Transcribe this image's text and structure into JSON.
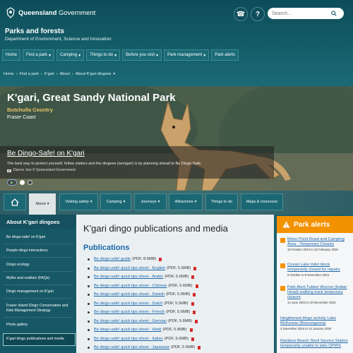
{
  "header": {
    "brand_strong": "Queensland",
    "brand_rest": " Government",
    "phone_icon": "☎",
    "help_icon": "?",
    "search_placeholder": "Search...",
    "site_title": "Parks and forests",
    "site_subtitle": "Department of Environment, Science and Innovation"
  },
  "main_nav": [
    {
      "label": "Home",
      "chevron": ""
    },
    {
      "label": "Find a park",
      "chevron": "▾"
    },
    {
      "label": "Camping",
      "chevron": "▾"
    },
    {
      "label": "Things to do",
      "chevron": "▾"
    },
    {
      "label": "Before you visit",
      "chevron": "▾"
    },
    {
      "label": "Park management",
      "chevron": "▾"
    },
    {
      "label": "Park alerts",
      "chevron": ""
    }
  ],
  "breadcrumb": [
    "Home",
    "Find a park",
    "K'gari",
    "About",
    "About K'gari dingoes"
  ],
  "breadcrumb_sep": "›",
  "hero": {
    "title": "K'gari, Great Sandy National Park",
    "country": "Butchulla Country",
    "region": "Fraser Coast",
    "caption_title": "Be Dingo-Safe! on K'gari",
    "caption_text": "The best way to protect yourself, fellow visitors and the dingoes (wongari) is by planning ahead to Be Dingo-Safe.",
    "caption_credit": "Darren Jew © Queensland Government"
  },
  "sub_nav": [
    {
      "label": "About",
      "chevron": "▾"
    },
    {
      "label": "Visiting safely",
      "chevron": "▾"
    },
    {
      "label": "Camping",
      "chevron": "▾"
    },
    {
      "label": "Journeys",
      "chevron": "▾"
    },
    {
      "label": "Attractions",
      "chevron": "▾"
    },
    {
      "label": "Things to do",
      "chevron": ""
    },
    {
      "label": "Maps & resources",
      "chevron": ""
    }
  ],
  "sidebar": {
    "heading": "About K'gari dingoes",
    "items": [
      "Be dingo-safe! on K'gari",
      "People-dingo interactions",
      "Dingo ecology",
      "Myths and realities (FAQs)",
      "Dingo management on K'gari",
      "Fraser Island Dingo Conservation and Risk Management Strategy",
      "Photo gallery",
      "K'gari dingo publications and media"
    ]
  },
  "content": {
    "title": "K'gari dingo publications and media",
    "section": "Publications",
    "publications": [
      {
        "link": "Be dingo-safe! guide",
        "meta": "(PDF, 8.6MB)"
      },
      {
        "link": "Be dingo-safe! quick tips sheet - English",
        "meta": "(PDF, 5.5MB)"
      },
      {
        "link": "Be dingo-safe! quick tips sheet - Arabic",
        "meta": "(PDF, 5.6MB)"
      },
      {
        "link": "Be dingo-safe! quick tips sheet - Chinese",
        "meta": "(PDF, 5.6MB)"
      },
      {
        "link": "Be dingo-safe! quick tips sheet - Danish",
        "meta": "(PDF, 5.6MB)"
      },
      {
        "link": "Be dingo-safe! quick tips sheet - Dutch",
        "meta": "(PDF, 5.5MB)"
      },
      {
        "link": "Be dingo-safe! quick tips sheet - French",
        "meta": "(PDF, 5.6MB)"
      },
      {
        "link": "Be dingo-safe! quick tips sheet - German",
        "meta": "(PDF, 5.6MB)"
      },
      {
        "link": "Be dingo-safe! quick tips sheet - Hindi",
        "meta": "(PDF, 5.8MB)"
      },
      {
        "link": "Be dingo-safe! quick tips sheet - Italian",
        "meta": "(PDF, 5.6MB)"
      },
      {
        "link": "Be dingo-safe! quick tips sheet - Japanese",
        "meta": "(PDF, 5.6MB)"
      }
    ]
  },
  "alerts": {
    "heading": "Park alerts",
    "items": [
      {
        "title": "Moon Point Road and Camping Area - Temporary Closure",
        "date": "18 October 2024 to 28 February 2025"
      },
      {
        "title": "Ocean Lake toilet block temporarily closed for repairs",
        "date": "8 October to 8 November 2024"
      },
      {
        "title": "Park Alert-Tuktee Wurroo (Indian Head) walking track temporary closure",
        "date": "14 June 2023 to 20 December 2024"
      },
      {
        "title": "Heightened dingo activity Lake McKenzie (Boorangoora)",
        "date": "3 November 2024 to 24 January 2025"
      },
      {
        "title": "Rainbow Beach Shell Service Station temporarily unable to take QPWS",
        "date": ""
      }
    ]
  },
  "colors": {
    "header_bg": "#0d4d59",
    "accent_orange": "#f39200",
    "link_blue": "#1b65a8",
    "hero_country": "#e9c46a"
  }
}
